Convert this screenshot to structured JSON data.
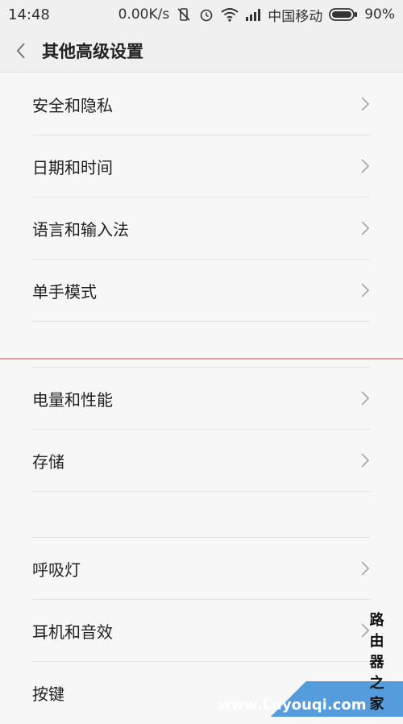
{
  "status_bar": {
    "time": "14:48",
    "speed": "0.00K/s",
    "carrier": "中国移动",
    "battery": "90%",
    "icons": [
      "vibrate-off-icon",
      "alarm-icon",
      "wifi-icon",
      "signal-icon",
      "battery-icon"
    ]
  },
  "header": {
    "back_icon": "chevron-left-icon",
    "title": "其他高级设置"
  },
  "menu": {
    "items": [
      {
        "label": "安全和隐私"
      },
      {
        "label": "日期和时间"
      },
      {
        "label": "语言和输入法"
      },
      {
        "label": "单手模式"
      },
      {
        "label": "电量和性能"
      },
      {
        "label": "存储"
      },
      {
        "label": "呼吸灯"
      },
      {
        "label": "耳机和音效"
      },
      {
        "label": "按键"
      }
    ]
  },
  "watermark": {
    "text": "路由器之家",
    "url_text": "www.Luyouqi.com"
  },
  "colors": {
    "background": "#f7f7f7",
    "divider": "#e3e3e3",
    "accent_line": "#e5a09a"
  }
}
